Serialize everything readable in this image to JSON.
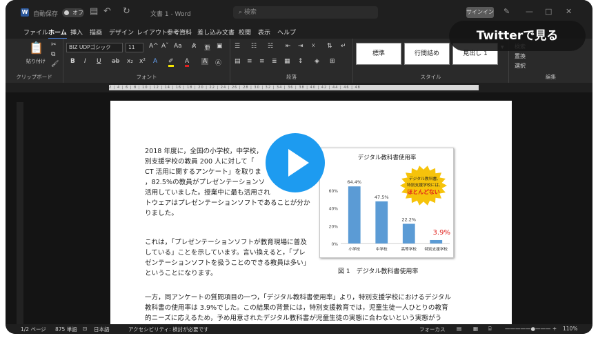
{
  "titlebar": {
    "app_icon": "W",
    "autosave_label": "自動保存",
    "autosave_state": "オフ",
    "doc_title": "文書 1 - Word",
    "search_placeholder": "検索",
    "signin_label": "サインイン",
    "min": "—",
    "max": "□",
    "close": "✕"
  },
  "tabs": [
    "ファイル",
    "ホーム",
    "挿入",
    "描画",
    "デザイン",
    "レイアウト",
    "参考資料",
    "差し込み文書",
    "校閲",
    "表示",
    "ヘルプ"
  ],
  "ribbon": {
    "clipboard": {
      "paste_label": "貼り付け",
      "group_label": "クリップボード"
    },
    "font": {
      "font_name": "BIZ UDPゴシック",
      "font_size": "11",
      "group_label": "フォント",
      "bold": "B",
      "italic": "I",
      "underline": "U",
      "strike": "ab",
      "sub": "x₂",
      "sup": "x²",
      "grow": "A^",
      "shrink": "Aˇ",
      "case": "Aa"
    },
    "paragraph": {
      "group_label": "段落"
    },
    "styles": {
      "items": [
        "標準",
        "行間詰め",
        "見出し 1"
      ],
      "group_label": "スタイル"
    },
    "editing": {
      "find": "検索",
      "replace": "置換",
      "select": "選択",
      "group_label": "編集"
    }
  },
  "ruler": {
    "marks": "2  |  4  |  6  |  8  |  10  |  12  |  14  |  16  |  18  |  20  |  22  |  24  |  26  |  28  |  30  |  32  |  34  |  36  |  38  |  40  |  42  |  44  |  46  |  48"
  },
  "document": {
    "p1": [
      "2018 年度に，全国の小学校，中学校，",
      "別支援学校の教員 200 人に対して「",
      "CT 活用に関するアンケート」を取りま",
      "，82.5%の教員がプレゼンテーションソ",
      "活用していました。授業中に最も活用され",
      "トウェアはプレゼンテーションソフトであることが分か",
      "りました。"
    ],
    "p2": [
      "これは，「プレゼンテーションソフトが教育現場に普及",
      "している」ことを示しています。言い換えると，「プレ",
      "ゼンテーションソフトを扱うことのできる教員は多い」",
      "ということになります。"
    ],
    "p3": [
      "一方，同アンケートの質問項目の一つ，「デジタル教科書使用率」より，特別支援学校におけるデジタル",
      "教科書の使用率は 3.9%でした。この結果の背景には，特別支援教育では，児童生徒一人ひとりの教育",
      "的ニーズに応えるため，予め用意されたデジタル教科書が児童生徒の実態に合わないという実態がう"
    ],
    "figure_caption": "図 1　デジタル教科書使用率"
  },
  "chart_data": {
    "type": "bar",
    "title": "デジタル教科書使用率",
    "categories": [
      "小学校",
      "中学校",
      "高等学校",
      "特別支援学校"
    ],
    "values": [
      64.4,
      47.5,
      22.2,
      3.9
    ],
    "data_labels": [
      "64.4%",
      "47.5%",
      "22.2%",
      "3.9%"
    ],
    "yticks": [
      "0%",
      "20%",
      "40%",
      "60%"
    ],
    "ylim": [
      0,
      70
    ],
    "bar_color": "#5b9bd5",
    "highlight_color": "#e0201b",
    "callout": [
      "デジタル教科書,",
      "特別支援学校には,",
      "ほとんどない"
    ]
  },
  "statusbar": {
    "page": "1/2 ページ",
    "words": "875 単語",
    "lang": "日本語",
    "accessibility": "アクセシビリティ: 検討が必要です",
    "focus": "フォーカス",
    "zoom": "110%"
  },
  "overlay": {
    "twitter_label": "Twitterで見る"
  },
  "colors": {
    "accent": "#1d9bf0",
    "word_blue": "#2b579a"
  }
}
